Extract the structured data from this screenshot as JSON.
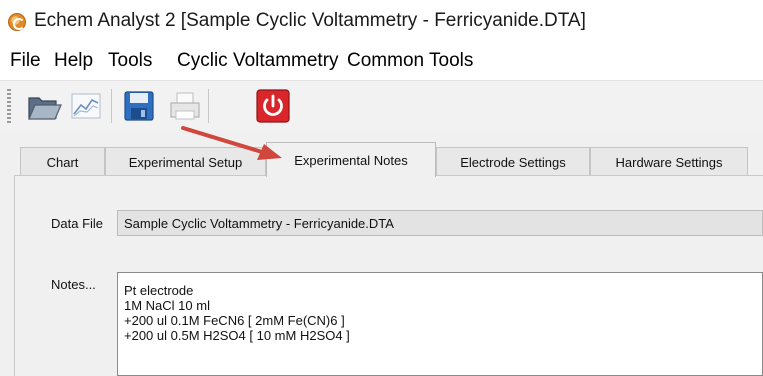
{
  "window": {
    "title": "Echem Analyst 2 [Sample Cyclic Voltammetry - Ferricyanide.DTA]",
    "app_icon": "echem-analyst-icon"
  },
  "menu": [
    "File",
    "Help",
    "Tools",
    "Cyclic Voltammetry",
    "Common Tools"
  ],
  "toolbar": {
    "buttons": [
      {
        "icon": "open-folder-icon"
      },
      {
        "icon": "chart-icon"
      },
      {
        "icon": "save-disk-icon"
      },
      {
        "icon": "print-icon"
      },
      {
        "icon": "power-icon"
      }
    ]
  },
  "tabs": {
    "items": [
      "Chart",
      "Experimental Setup",
      "Experimental Notes",
      "Electrode Settings",
      "Hardware Settings"
    ],
    "active": "Experimental Notes"
  },
  "notes_panel": {
    "data_file_label": "Data File",
    "data_file_value": "Sample Cyclic Voltammetry - Ferricyanide.DTA",
    "notes_label": "Notes...",
    "notes_lines": [
      "Pt electrode",
      "1M NaCl 10 ml",
      "+200 ul 0.1M FeCN6 [ 2mM Fe(CN)6 ]",
      "+200 ul 0.5M H2SO4 [ 10 mM H2SO4 ]"
    ]
  },
  "colors": {
    "annotation_arrow": "#d0473d",
    "power_button": "#d9262b",
    "save_button": "#2e6fc1"
  }
}
